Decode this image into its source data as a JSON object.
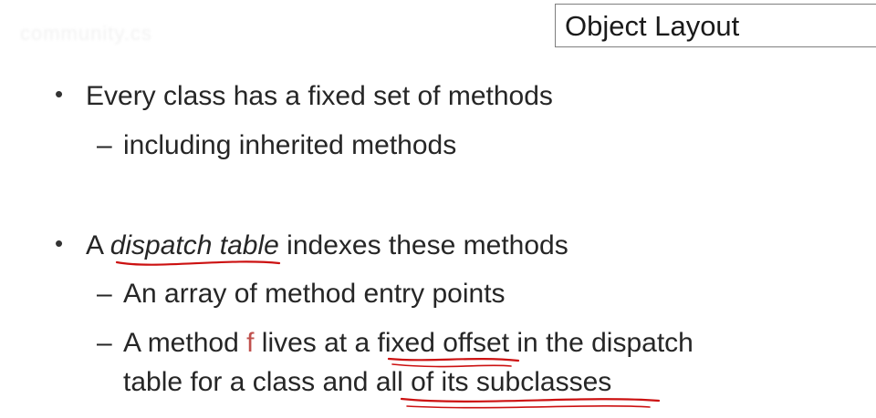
{
  "watermark": "community.cs",
  "title": "Object Layout",
  "bullets": [
    {
      "text": "Every class has a fixed set of methods",
      "sub": [
        "including inherited methods"
      ]
    },
    {
      "pre": "A ",
      "emph": "dispatch table",
      "post": " indexes these methods",
      "sub": [
        "An array of method entry points"
      ],
      "sub2": {
        "a": "A method ",
        "f": "f",
        "b": " lives at ",
        "c": "a fixed offset",
        "d": " in the dispatch",
        "e": "table for a class and ",
        "g": "all of its subclasses"
      }
    }
  ],
  "colors": {
    "text": "#262626",
    "accent_f": "#c0504d",
    "annotation_ink": "#cc1111",
    "title_border": "#7f7f7f"
  }
}
